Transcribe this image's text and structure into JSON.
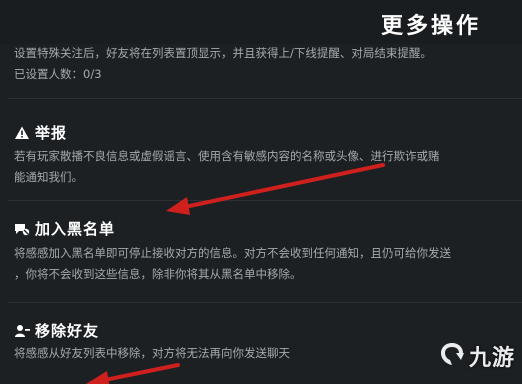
{
  "header": {
    "title": "更多操作"
  },
  "special_follow": {
    "desc": "设置特殊关注后，好友将在列表置顶显示，并且获得上/下线提醒、对局结束提醒。",
    "count": "已设置人数：0/3"
  },
  "report": {
    "label": "举报",
    "icon": "warning-icon",
    "desc_line1": "若有玩家散播不良信息或虚假谣言、使用含有敏感内容的名称或头像、进行欺诈或赌",
    "desc_line2": "能通知我们。"
  },
  "blacklist": {
    "label": "加入黑名单",
    "icon": "block-chat-icon",
    "desc_line1": "将感感加入黑名单即可停止接收对方的信息。对方不会收到任何通知，且仍可给你发送",
    "desc_line2": "，你将不会收到这些信息，除非你将其从黑名单中移除。"
  },
  "remove_friend": {
    "label": "移除好友",
    "icon": "remove-user-icon",
    "desc_line1": "将感感从好友列表中移除，对方将无法再向你发送聊天"
  },
  "annotations": {
    "arrow_color": "#d0201e"
  },
  "watermark": {
    "text": "九游",
    "icon": "jiuyou-logo-icon"
  }
}
